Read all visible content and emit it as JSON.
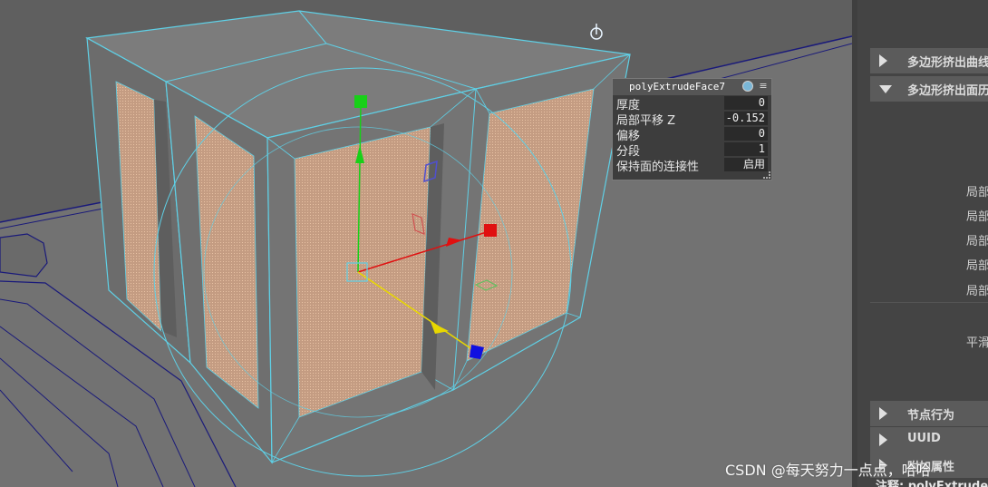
{
  "channel_box": {
    "title": "polyExtrudeFace7",
    "rows": [
      {
        "name": "厚度",
        "value": "0"
      },
      {
        "name": "局部平移 Z",
        "value": "-0.152"
      },
      {
        "name": "偏移",
        "value": "0"
      },
      {
        "name": "分段",
        "value": "1"
      },
      {
        "name": "保持面的连接性",
        "value": "启用"
      }
    ]
  },
  "attribute_editor": {
    "sections": [
      {
        "label": "多边形挤出曲线",
        "state": "collapsed"
      },
      {
        "label": "多边形挤出面历",
        "state": "expanded"
      },
      {
        "label": "节点行为",
        "state": "collapsed"
      },
      {
        "label": "UUID",
        "state": "collapsed"
      },
      {
        "label": "附加属性",
        "state": "collapsed"
      }
    ],
    "sub_labels": [
      "局部",
      "局部",
      "局部",
      "局部",
      "局部",
      "平滑"
    ],
    "note": "注释: polyExtrude"
  },
  "watermark": "CSDN @每天努力一点点，哈哈",
  "colors": {
    "viewport_bg": "#727272",
    "wire": "#5fd0e6",
    "face_fill": "#c9a48a",
    "manip_x": "#e01010",
    "manip_y": "#18d018",
    "manip_z": "#1010e0",
    "manip_scale": "#e8d800"
  },
  "icons": [
    "pivot-icon",
    "gear-icon",
    "menu-icon",
    "expand-arrow-icon"
  ]
}
